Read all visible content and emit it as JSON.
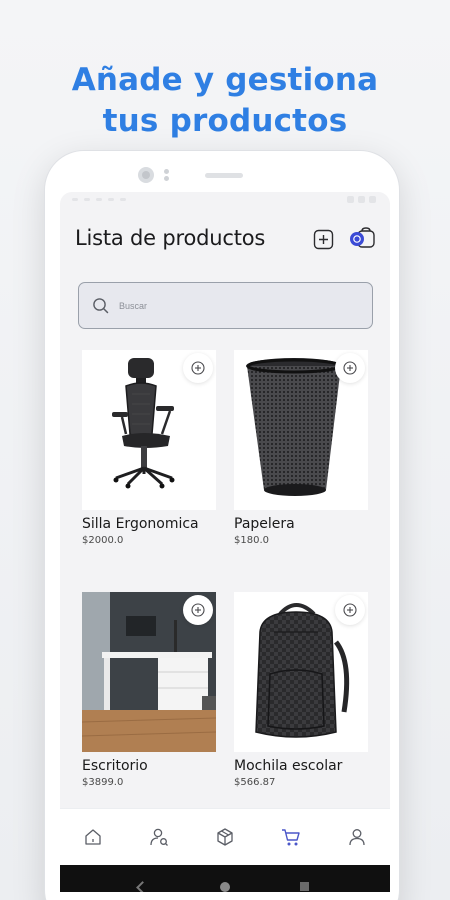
{
  "promo": {
    "line1": "Añade y gestiona",
    "line2": "tus productos"
  },
  "header": {
    "title": "Lista de productos",
    "add_icon": "plus-square-icon",
    "cart_icon": "cart-icon",
    "cart_badge_color": "#3b4bd6"
  },
  "search": {
    "placeholder": "Buscar",
    "value": ""
  },
  "products": [
    {
      "name": "Silla Ergonomica",
      "price": "$2000.0",
      "image": "office-chair"
    },
    {
      "name": "Papelera",
      "price": "$180.0",
      "image": "wastebasket"
    },
    {
      "name": "Escritorio",
      "price": "$3899.0",
      "image": "desk-room"
    },
    {
      "name": "Mochila escolar",
      "price": "$566.87",
      "image": "backpack"
    }
  ],
  "bottom_nav": [
    {
      "icon": "home-icon"
    },
    {
      "icon": "user-search-icon"
    },
    {
      "icon": "box-icon"
    },
    {
      "icon": "cart-icon",
      "active": true
    },
    {
      "icon": "profile-icon"
    }
  ],
  "colors": {
    "accent": "#2f7fe3",
    "active_nav": "#4b57c9",
    "icon": "#5b5e66"
  }
}
